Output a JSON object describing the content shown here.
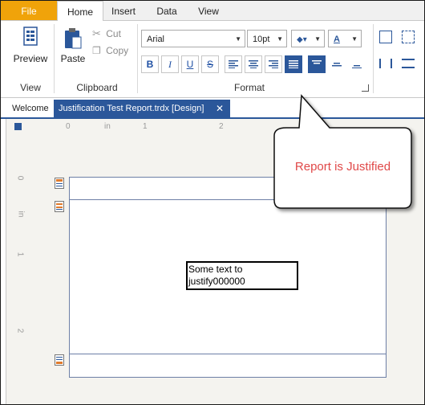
{
  "ribbon_tabs": {
    "file": "File",
    "home": "Home",
    "insert": "Insert",
    "data": "Data",
    "view": "View"
  },
  "ribbon": {
    "view_group": {
      "preview_label": "Preview",
      "group_label": "View"
    },
    "clipboard_group": {
      "paste_label": "Paste",
      "cut_label": "Cut",
      "copy_label": "Copy",
      "group_label": "Clipboard"
    },
    "format_group": {
      "font_name": "Arial",
      "font_size": "10pt",
      "bold": "B",
      "italic": "I",
      "underline": "U",
      "strikethrough": "S",
      "font_color_glyph": "A",
      "group_label": "Format"
    }
  },
  "document_tabs": {
    "welcome": "Welcome",
    "active": "Justification Test Report.trdx [Design]",
    "close_glyph": "✕"
  },
  "rulers": {
    "horizontal": [
      "0",
      "in",
      "1",
      "2"
    ],
    "vertical": [
      "0",
      "in",
      "1",
      "2"
    ]
  },
  "report": {
    "textbox_text": "Some text to justify000000"
  },
  "callout": {
    "text": "Report is Justified"
  },
  "colors": {
    "file_tab": "#f0a30a",
    "accent": "#2b579a",
    "callout_text": "#e04848"
  }
}
